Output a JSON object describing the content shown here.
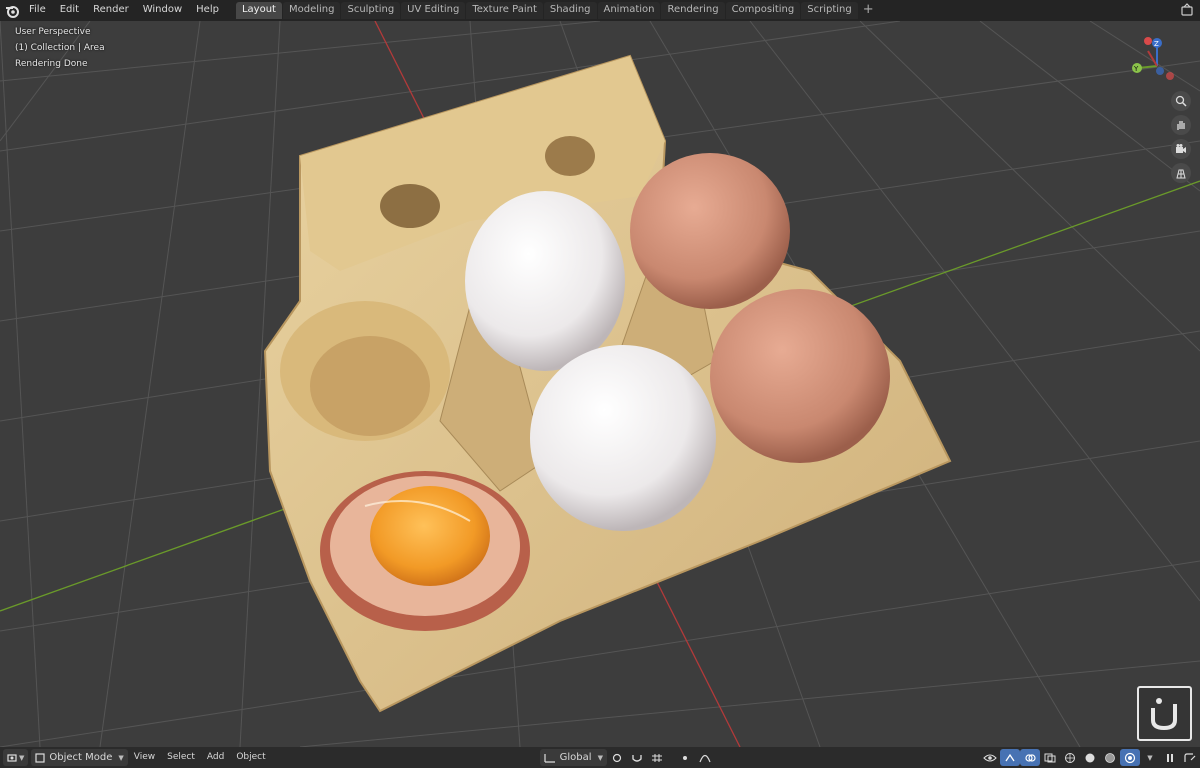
{
  "topbar": {
    "menus": [
      "File",
      "Edit",
      "Render",
      "Window",
      "Help"
    ],
    "tabs": [
      "Layout",
      "Modeling",
      "Sculpting",
      "UV Editing",
      "Texture Paint",
      "Shading",
      "Animation",
      "Rendering",
      "Compositing",
      "Scripting"
    ],
    "active_tab": "Layout",
    "add_tab_glyph": "+"
  },
  "viewport": {
    "view_name": "User Perspective",
    "collection_info": "(1) Collection | Area",
    "status": "Rendering Done",
    "gizmo_labels": {
      "z": "Z",
      "y": "Y"
    }
  },
  "bottombar": {
    "mode": "Object Mode",
    "menus": [
      "View",
      "Select",
      "Add",
      "Object"
    ],
    "orientation": "Global"
  },
  "colors": {
    "accent": "#4772b3",
    "x_axis": "#b23a3a",
    "y_axis": "#6a9a2a",
    "grid_bg": "#3d3d3d"
  }
}
